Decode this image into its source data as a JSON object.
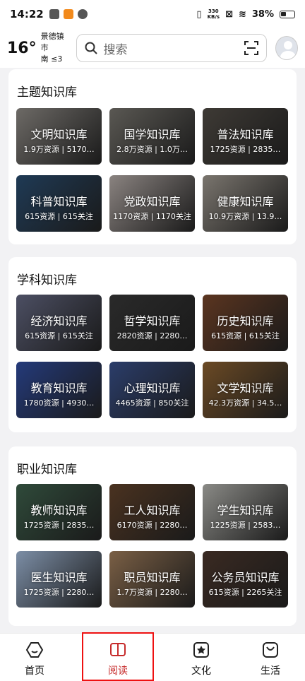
{
  "status_bar": {
    "time": "14:22",
    "net_speed_top": "330",
    "net_speed_bottom": "KB/s",
    "battery": "38%"
  },
  "header": {
    "temperature": "16°",
    "city": "景德镇市",
    "weather": "南 ≤3",
    "search_placeholder": "搜索"
  },
  "sections": [
    {
      "title": "主题知识库",
      "cards": [
        {
          "title": "文明知识库",
          "stats": "1.9万资源 | 5170…",
          "color": "#6d6a66"
        },
        {
          "title": "国学知识库",
          "stats": "2.8万资源 | 1.0万…",
          "color": "#5a5853"
        },
        {
          "title": "普法知识库",
          "stats": "1725资源 | 2835…",
          "color": "#3e3a35"
        },
        {
          "title": "科普知识库",
          "stats": "615资源 | 615关注",
          "color": "#1f3a55"
        },
        {
          "title": "党政知识库",
          "stats": "1170资源 | 1170关注",
          "color": "#8a8380"
        },
        {
          "title": "健康知识库",
          "stats": "10.9万资源 | 13.9…",
          "color": "#7a756e"
        }
      ]
    },
    {
      "title": "学科知识库",
      "cards": [
        {
          "title": "经济知识库",
          "stats": "615资源 | 615关注",
          "color": "#4c4f63"
        },
        {
          "title": "哲学知识库",
          "stats": "2820资源 | 2280…",
          "color": "#2a2a2a"
        },
        {
          "title": "历史知识库",
          "stats": "615资源 | 615关注",
          "color": "#5b3520"
        },
        {
          "title": "教育知识库",
          "stats": "1780资源 | 4930…",
          "color": "#243a7a"
        },
        {
          "title": "心理知识库",
          "stats": "4465资源 | 850关注",
          "color": "#2b3d6a"
        },
        {
          "title": "文学知识库",
          "stats": "42.3万资源 | 34.5…",
          "color": "#6b4a25"
        }
      ]
    },
    {
      "title": "职业知识库",
      "cards": [
        {
          "title": "教师知识库",
          "stats": "1725资源 | 2835…",
          "color": "#2f4a3a"
        },
        {
          "title": "工人知识库",
          "stats": "6170资源 | 2280…",
          "color": "#4a3220"
        },
        {
          "title": "学生知识库",
          "stats": "1225资源 | 2583…",
          "color": "#8a8a86"
        },
        {
          "title": "医生知识库",
          "stats": "1725资源 | 2280…",
          "color": "#7c8ea6"
        },
        {
          "title": "职员知识库",
          "stats": "1.7万资源 | 2280…",
          "color": "#7a5f45"
        },
        {
          "title": "公务员知识库",
          "stats": "615资源 | 2265关注",
          "color": "#3a2a22"
        }
      ]
    }
  ],
  "bottom_nav": [
    {
      "label": "首页",
      "icon": "home-icon"
    },
    {
      "label": "阅读",
      "icon": "book-icon",
      "active": true
    },
    {
      "label": "文化",
      "icon": "culture-star-icon"
    },
    {
      "label": "生活",
      "icon": "life-bag-icon"
    }
  ]
}
